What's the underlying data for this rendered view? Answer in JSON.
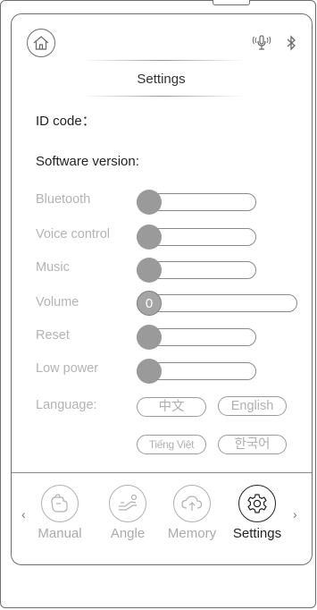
{
  "header": {
    "title": "Settings",
    "home_icon": "home-icon",
    "voice_icon": "voice-icon",
    "bluetooth_icon": "bluetooth-icon"
  },
  "info": {
    "id_code_label": "ID code：",
    "software_version_label": "Software version:"
  },
  "settings": [
    {
      "label": "Bluetooth",
      "state": "off"
    },
    {
      "label": "Voice control",
      "state": "off"
    },
    {
      "label": "Music",
      "state": "off"
    },
    {
      "label": "Volume",
      "value": "0"
    },
    {
      "label": "Reset",
      "state": "off"
    },
    {
      "label": "Low power",
      "state": "off"
    }
  ],
  "language": {
    "label": "Language:",
    "options": [
      "中文",
      "English",
      "Tiếng Việt",
      "한국어"
    ]
  },
  "nav": {
    "prev": "‹",
    "next": "›",
    "items": [
      {
        "label": "Manual",
        "icon": "hand-icon",
        "active": false
      },
      {
        "label": "Angle",
        "icon": "recline-icon",
        "active": false
      },
      {
        "label": "Memory",
        "icon": "cloud-upload-icon",
        "active": false
      },
      {
        "label": "Settings",
        "icon": "gear-icon",
        "active": true
      }
    ]
  },
  "colors": {
    "border": "#6e6e6e",
    "inactive_text": "#b4b4b4",
    "knob": "#9a9a9a",
    "active_text": "#222222"
  }
}
